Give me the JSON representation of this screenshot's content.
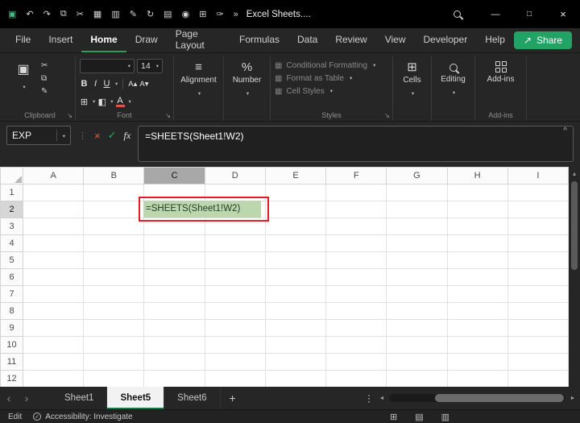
{
  "titlebar": {
    "title": "Excel Sheets....",
    "qat_icons": [
      {
        "name": "save-icon",
        "glyph": "▣",
        "accent": true
      },
      {
        "name": "undo-icon",
        "glyph": "↶"
      },
      {
        "name": "redo-icon",
        "glyph": "↷"
      },
      {
        "name": "copy-icon",
        "glyph": "⧉"
      },
      {
        "name": "cut-icon",
        "glyph": "✂"
      },
      {
        "name": "picture-icon",
        "glyph": "▦"
      },
      {
        "name": "chart-icon",
        "glyph": "▥"
      },
      {
        "name": "format-painter-icon",
        "glyph": "✎"
      },
      {
        "name": "repeat-icon",
        "glyph": "↻"
      },
      {
        "name": "new-document-icon",
        "glyph": "▤"
      },
      {
        "name": "camera-icon",
        "glyph": "◉"
      },
      {
        "name": "table-icon",
        "glyph": "⊞"
      },
      {
        "name": "draw-icon",
        "glyph": "✑"
      },
      {
        "name": "overflow-icon",
        "glyph": "»"
      }
    ],
    "window_controls": {
      "minimize": "—",
      "maximize": "□",
      "close": "×"
    }
  },
  "menubar": {
    "tabs": [
      "File",
      "Insert",
      "Home",
      "Draw",
      "Page Layout",
      "Formulas",
      "Data",
      "Review",
      "View",
      "Developer",
      "Help"
    ],
    "active": "Home",
    "share": {
      "label": "Share",
      "icon": "↗"
    }
  },
  "ribbon": {
    "clipboard": {
      "label": "Clipboard",
      "paste_icon": "▣",
      "cut_icon": "✂",
      "copy_icon": "⧉",
      "painter_icon": "✎"
    },
    "font": {
      "label": "Font",
      "size": "14",
      "bold": "B",
      "italic": "I",
      "underline": "U",
      "grow": "A▴",
      "shrink": "A▾",
      "borders": "⊞",
      "fill": "◧",
      "color": "A"
    },
    "alignment": {
      "label": "Alignment",
      "icon": "≡"
    },
    "number": {
      "label": "Number",
      "icon": "%"
    },
    "styles": {
      "label": "Styles",
      "item_icon": "▦",
      "items": [
        "Conditional Formatting",
        "Format as Table",
        "Cell Styles"
      ]
    },
    "cells": {
      "label": "Cells",
      "icon": "⊞"
    },
    "editing": {
      "label": "Editing"
    },
    "addins": {
      "label": "Add-ins",
      "button": "Add-ins"
    }
  },
  "formula_bar": {
    "name_box": "EXP",
    "cancel": "×",
    "enter": "✓",
    "fx": "fx",
    "formula": "=SHEETS(Sheet1!W2)",
    "collapse": "^"
  },
  "grid": {
    "columns": [
      "A",
      "B",
      "C",
      "D",
      "E",
      "F",
      "G",
      "H",
      "I"
    ],
    "rows": [
      "1",
      "2",
      "3",
      "4",
      "5",
      "6",
      "7",
      "8",
      "9",
      "10",
      "11",
      "12"
    ],
    "selected_column": "C",
    "selected_row": "2",
    "active_cell": {
      "ref": "C2",
      "value": "=SHEETS(Sheet1!W2)"
    }
  },
  "sheet_tabs": {
    "tabs": [
      "Sheet1",
      "Sheet5",
      "Sheet6"
    ],
    "active": "Sheet5",
    "add": "+",
    "menu": "⋮",
    "nav_left": "‹",
    "nav_right": "›",
    "scroll_left": "◄",
    "scroll_right": "►"
  },
  "status_bar": {
    "mode": "Edit",
    "check": "✓",
    "accessibility": "Accessibility: Investigate",
    "views": [
      {
        "name": "normal-view-icon",
        "glyph": "⊞"
      },
      {
        "name": "page-layout-view-icon",
        "glyph": "▤"
      },
      {
        "name": "page-break-view-icon",
        "glyph": "▥"
      }
    ]
  },
  "colors": {
    "accent_green": "#107C41",
    "share_green": "#21A366",
    "annotation_red": "#E02020",
    "cell_fill_green": "#BCD6AE",
    "titlebar_black": "#000000",
    "ribbon_gray": "#262626"
  }
}
